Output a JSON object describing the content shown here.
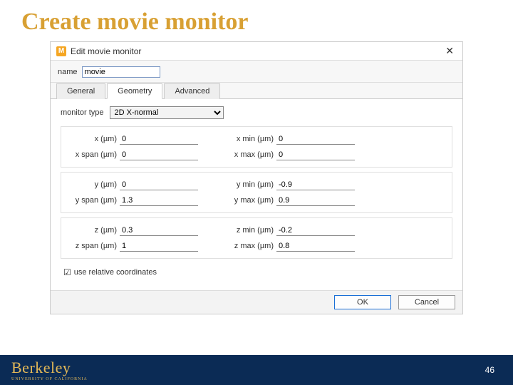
{
  "slide": {
    "title": "Create movie monitor",
    "page": "46"
  },
  "footer": {
    "logo": "Berkeley",
    "subtitle": "UNIVERSITY OF CALIFORNIA"
  },
  "dialog": {
    "title": "Edit movie monitor",
    "name_label": "name",
    "name_value": "movie",
    "tabs": {
      "general": "General",
      "geometry": "Geometry",
      "advanced": "Advanced"
    },
    "monitor_type_label": "monitor type",
    "monitor_type_value": "2D X-normal",
    "groups": [
      {
        "a_lbl": "x (µm)",
        "a_val": "0",
        "b_lbl": "x min (µm)",
        "b_val": "0",
        "c_lbl": "x span (µm)",
        "c_val": "0",
        "d_lbl": "x max (µm)",
        "d_val": "0"
      },
      {
        "a_lbl": "y (µm)",
        "a_val": "0",
        "b_lbl": "y min (µm)",
        "b_val": "-0.9",
        "c_lbl": "y span (µm)",
        "c_val": "1.3",
        "d_lbl": "y max (µm)",
        "d_val": "0.9"
      },
      {
        "a_lbl": "z (µm)",
        "a_val": "0.3",
        "b_lbl": "z min (µm)",
        "b_val": "-0.2",
        "c_lbl": "z span (µm)",
        "c_val": "1",
        "d_lbl": "z max (µm)",
        "d_val": "0.8"
      }
    ],
    "use_relative": "use relative coordinates",
    "ok": "OK",
    "cancel": "Cancel"
  }
}
